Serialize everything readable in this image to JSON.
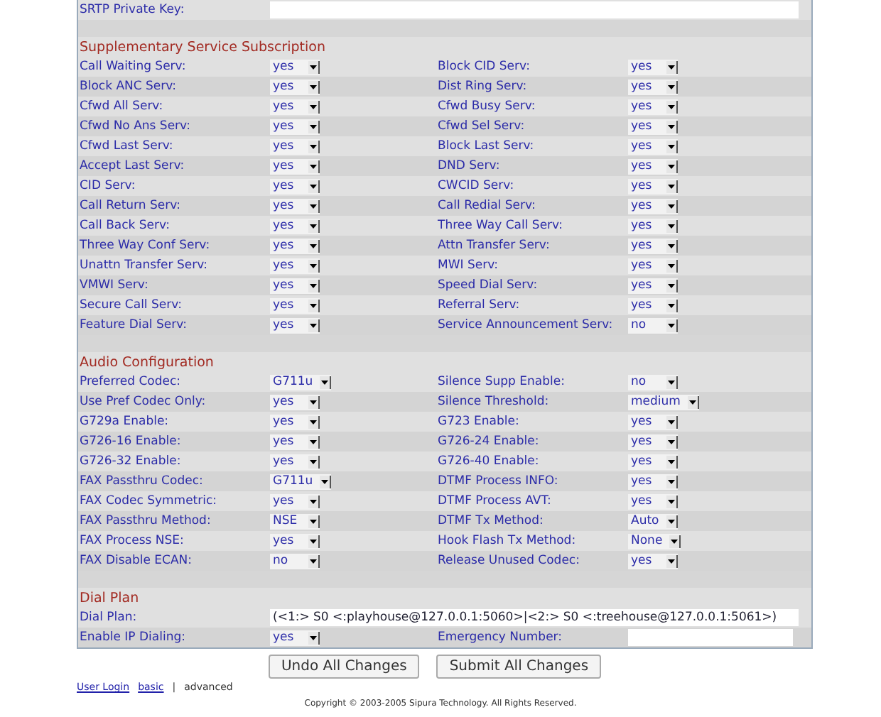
{
  "sections": [
    {
      "fields": [
        {
          "label": "SRTP Private Key:",
          "kind": "wide-text"
        }
      ]
    },
    {
      "heading": "Supplementary Service Subscription",
      "fields": [
        {
          "label": "Call Waiting Serv:",
          "kind": "select",
          "value": "yes"
        },
        {
          "label": "Block CID Serv:",
          "kind": "select",
          "value": "yes"
        },
        {
          "label": "Block ANC Serv:",
          "kind": "select",
          "value": "yes"
        },
        {
          "label": "Dist Ring Serv:",
          "kind": "select",
          "value": "yes"
        },
        {
          "label": "Cfwd All Serv:",
          "kind": "select",
          "value": "yes"
        },
        {
          "label": "Cfwd Busy Serv:",
          "kind": "select",
          "value": "yes"
        },
        {
          "label": "Cfwd No Ans Serv:",
          "kind": "select",
          "value": "yes"
        },
        {
          "label": "Cfwd Sel Serv:",
          "kind": "select",
          "value": "yes"
        },
        {
          "label": "Cfwd Last Serv:",
          "kind": "select",
          "value": "yes"
        },
        {
          "label": "Block Last Serv:",
          "kind": "select",
          "value": "yes"
        },
        {
          "label": "Accept Last Serv:",
          "kind": "select",
          "value": "yes"
        },
        {
          "label": "DND Serv:",
          "kind": "select",
          "value": "yes"
        },
        {
          "label": "CID Serv:",
          "kind": "select",
          "value": "yes"
        },
        {
          "label": "CWCID Serv:",
          "kind": "select",
          "value": "yes"
        },
        {
          "label": "Call Return Serv:",
          "kind": "select",
          "value": "yes"
        },
        {
          "label": "Call Redial Serv:",
          "kind": "select",
          "value": "yes"
        },
        {
          "label": "Call Back Serv:",
          "kind": "select",
          "value": "yes"
        },
        {
          "label": "Three Way Call Serv:",
          "kind": "select",
          "value": "yes"
        },
        {
          "label": "Three Way Conf Serv:",
          "kind": "select",
          "value": "yes"
        },
        {
          "label": "Attn Transfer Serv:",
          "kind": "select",
          "value": "yes"
        },
        {
          "label": "Unattn Transfer Serv:",
          "kind": "select",
          "value": "yes"
        },
        {
          "label": "MWI Serv:",
          "kind": "select",
          "value": "yes"
        },
        {
          "label": "VMWI Serv:",
          "kind": "select",
          "value": "yes"
        },
        {
          "label": "Speed Dial Serv:",
          "kind": "select",
          "value": "yes"
        },
        {
          "label": "Secure Call Serv:",
          "kind": "select",
          "value": "yes"
        },
        {
          "label": "Referral Serv:",
          "kind": "select",
          "value": "yes"
        },
        {
          "label": "Feature Dial Serv:",
          "kind": "select",
          "value": "yes"
        },
        {
          "label": "Service Announcement Serv:",
          "kind": "select",
          "value": "no"
        }
      ]
    },
    {
      "heading": "Audio Configuration",
      "fields": [
        {
          "label": "Preferred Codec:",
          "kind": "select",
          "value": "G711u"
        },
        {
          "label": "Silence Supp Enable:",
          "kind": "select",
          "value": "no"
        },
        {
          "label": "Use Pref Codec Only:",
          "kind": "select",
          "value": "yes"
        },
        {
          "label": "Silence Threshold:",
          "kind": "select",
          "value": "medium"
        },
        {
          "label": "G729a Enable:",
          "kind": "select",
          "value": "yes"
        },
        {
          "label": "G723 Enable:",
          "kind": "select",
          "value": "yes"
        },
        {
          "label": "G726-16 Enable:",
          "kind": "select",
          "value": "yes"
        },
        {
          "label": "G726-24 Enable:",
          "kind": "select",
          "value": "yes"
        },
        {
          "label": "G726-32 Enable:",
          "kind": "select",
          "value": "yes"
        },
        {
          "label": "G726-40 Enable:",
          "kind": "select",
          "value": "yes"
        },
        {
          "label": "FAX Passthru Codec:",
          "kind": "select",
          "value": "G711u"
        },
        {
          "label": "DTMF Process INFO:",
          "kind": "select",
          "value": "yes"
        },
        {
          "label": "FAX Codec Symmetric:",
          "kind": "select",
          "value": "yes"
        },
        {
          "label": "DTMF Process AVT:",
          "kind": "select",
          "value": "yes"
        },
        {
          "label": "FAX Passthru Method:",
          "kind": "select",
          "value": "NSE"
        },
        {
          "label": "DTMF Tx Method:",
          "kind": "select",
          "value": "Auto"
        },
        {
          "label": "FAX Process NSE:",
          "kind": "select",
          "value": "yes"
        },
        {
          "label": "Hook Flash Tx Method:",
          "kind": "select",
          "value": "None"
        },
        {
          "label": "FAX Disable ECAN:",
          "kind": "select",
          "value": "no"
        },
        {
          "label": "Release Unused Codec:",
          "kind": "select",
          "value": "yes"
        }
      ]
    },
    {
      "heading": "Dial Plan",
      "fields": [
        {
          "label": "Dial Plan:",
          "kind": "wide-text",
          "value": "(<1:> S0 <:playhouse@127.0.0.1:5060>|<2:> S0 <:treehouse@127.0.0.1:5061>)"
        },
        {
          "label": "Enable IP Dialing:",
          "kind": "select",
          "value": "yes"
        },
        {
          "label": "Emergency Number:",
          "kind": "text"
        }
      ]
    }
  ],
  "buttons": [
    "Undo All Changes",
    "Submit All Changes"
  ],
  "links": [
    {
      "label": "User Login",
      "selected": false
    },
    {
      "label": "basic",
      "selected": false
    },
    {
      "label": "advanced",
      "selected": true
    }
  ],
  "separator": "|",
  "copyright": "Copyright © 2003-2005 Sipura Technology. All Rights Reserved."
}
